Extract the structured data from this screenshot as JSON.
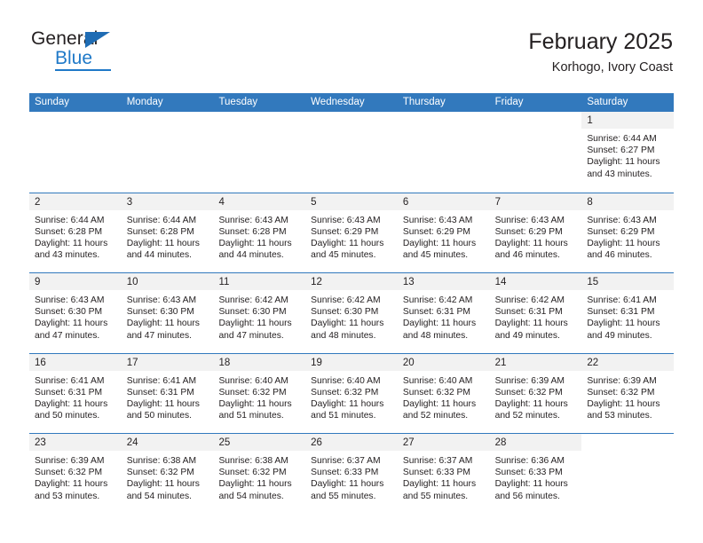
{
  "brand": {
    "name_top": "General",
    "name_bottom": "Blue",
    "triangle_icon": "brand-triangle-icon",
    "color_blue": "#1f79c8",
    "color_dark": "#231f20"
  },
  "header": {
    "title": "February 2025",
    "subtitle": "Korhogo, Ivory Coast"
  },
  "theme": {
    "header_bar": "#3279bd",
    "day_band": "#f2f2f2",
    "text": "#231f20"
  },
  "weekdays": [
    "Sunday",
    "Monday",
    "Tuesday",
    "Wednesday",
    "Thursday",
    "Friday",
    "Saturday"
  ],
  "weeks": [
    [
      {
        "day": "",
        "sunrise": "",
        "sunset": "",
        "daylight_line1": "",
        "daylight_line2": "",
        "empty": true
      },
      {
        "day": "",
        "sunrise": "",
        "sunset": "",
        "daylight_line1": "",
        "daylight_line2": "",
        "empty": true
      },
      {
        "day": "",
        "sunrise": "",
        "sunset": "",
        "daylight_line1": "",
        "daylight_line2": "",
        "empty": true
      },
      {
        "day": "",
        "sunrise": "",
        "sunset": "",
        "daylight_line1": "",
        "daylight_line2": "",
        "empty": true
      },
      {
        "day": "",
        "sunrise": "",
        "sunset": "",
        "daylight_line1": "",
        "daylight_line2": "",
        "empty": true
      },
      {
        "day": "",
        "sunrise": "",
        "sunset": "",
        "daylight_line1": "",
        "daylight_line2": "",
        "empty": true
      },
      {
        "day": "1",
        "sunrise": "Sunrise: 6:44 AM",
        "sunset": "Sunset: 6:27 PM",
        "daylight_line1": "Daylight: 11 hours",
        "daylight_line2": "and 43 minutes."
      }
    ],
    [
      {
        "day": "2",
        "sunrise": "Sunrise: 6:44 AM",
        "sunset": "Sunset: 6:28 PM",
        "daylight_line1": "Daylight: 11 hours",
        "daylight_line2": "and 43 minutes."
      },
      {
        "day": "3",
        "sunrise": "Sunrise: 6:44 AM",
        "sunset": "Sunset: 6:28 PM",
        "daylight_line1": "Daylight: 11 hours",
        "daylight_line2": "and 44 minutes."
      },
      {
        "day": "4",
        "sunrise": "Sunrise: 6:43 AM",
        "sunset": "Sunset: 6:28 PM",
        "daylight_line1": "Daylight: 11 hours",
        "daylight_line2": "and 44 minutes."
      },
      {
        "day": "5",
        "sunrise": "Sunrise: 6:43 AM",
        "sunset": "Sunset: 6:29 PM",
        "daylight_line1": "Daylight: 11 hours",
        "daylight_line2": "and 45 minutes."
      },
      {
        "day": "6",
        "sunrise": "Sunrise: 6:43 AM",
        "sunset": "Sunset: 6:29 PM",
        "daylight_line1": "Daylight: 11 hours",
        "daylight_line2": "and 45 minutes."
      },
      {
        "day": "7",
        "sunrise": "Sunrise: 6:43 AM",
        "sunset": "Sunset: 6:29 PM",
        "daylight_line1": "Daylight: 11 hours",
        "daylight_line2": "and 46 minutes."
      },
      {
        "day": "8",
        "sunrise": "Sunrise: 6:43 AM",
        "sunset": "Sunset: 6:29 PM",
        "daylight_line1": "Daylight: 11 hours",
        "daylight_line2": "and 46 minutes."
      }
    ],
    [
      {
        "day": "9",
        "sunrise": "Sunrise: 6:43 AM",
        "sunset": "Sunset: 6:30 PM",
        "daylight_line1": "Daylight: 11 hours",
        "daylight_line2": "and 47 minutes."
      },
      {
        "day": "10",
        "sunrise": "Sunrise: 6:43 AM",
        "sunset": "Sunset: 6:30 PM",
        "daylight_line1": "Daylight: 11 hours",
        "daylight_line2": "and 47 minutes."
      },
      {
        "day": "11",
        "sunrise": "Sunrise: 6:42 AM",
        "sunset": "Sunset: 6:30 PM",
        "daylight_line1": "Daylight: 11 hours",
        "daylight_line2": "and 47 minutes."
      },
      {
        "day": "12",
        "sunrise": "Sunrise: 6:42 AM",
        "sunset": "Sunset: 6:30 PM",
        "daylight_line1": "Daylight: 11 hours",
        "daylight_line2": "and 48 minutes."
      },
      {
        "day": "13",
        "sunrise": "Sunrise: 6:42 AM",
        "sunset": "Sunset: 6:31 PM",
        "daylight_line1": "Daylight: 11 hours",
        "daylight_line2": "and 48 minutes."
      },
      {
        "day": "14",
        "sunrise": "Sunrise: 6:42 AM",
        "sunset": "Sunset: 6:31 PM",
        "daylight_line1": "Daylight: 11 hours",
        "daylight_line2": "and 49 minutes."
      },
      {
        "day": "15",
        "sunrise": "Sunrise: 6:41 AM",
        "sunset": "Sunset: 6:31 PM",
        "daylight_line1": "Daylight: 11 hours",
        "daylight_line2": "and 49 minutes."
      }
    ],
    [
      {
        "day": "16",
        "sunrise": "Sunrise: 6:41 AM",
        "sunset": "Sunset: 6:31 PM",
        "daylight_line1": "Daylight: 11 hours",
        "daylight_line2": "and 50 minutes."
      },
      {
        "day": "17",
        "sunrise": "Sunrise: 6:41 AM",
        "sunset": "Sunset: 6:31 PM",
        "daylight_line1": "Daylight: 11 hours",
        "daylight_line2": "and 50 minutes."
      },
      {
        "day": "18",
        "sunrise": "Sunrise: 6:40 AM",
        "sunset": "Sunset: 6:32 PM",
        "daylight_line1": "Daylight: 11 hours",
        "daylight_line2": "and 51 minutes."
      },
      {
        "day": "19",
        "sunrise": "Sunrise: 6:40 AM",
        "sunset": "Sunset: 6:32 PM",
        "daylight_line1": "Daylight: 11 hours",
        "daylight_line2": "and 51 minutes."
      },
      {
        "day": "20",
        "sunrise": "Sunrise: 6:40 AM",
        "sunset": "Sunset: 6:32 PM",
        "daylight_line1": "Daylight: 11 hours",
        "daylight_line2": "and 52 minutes."
      },
      {
        "day": "21",
        "sunrise": "Sunrise: 6:39 AM",
        "sunset": "Sunset: 6:32 PM",
        "daylight_line1": "Daylight: 11 hours",
        "daylight_line2": "and 52 minutes."
      },
      {
        "day": "22",
        "sunrise": "Sunrise: 6:39 AM",
        "sunset": "Sunset: 6:32 PM",
        "daylight_line1": "Daylight: 11 hours",
        "daylight_line2": "and 53 minutes."
      }
    ],
    [
      {
        "day": "23",
        "sunrise": "Sunrise: 6:39 AM",
        "sunset": "Sunset: 6:32 PM",
        "daylight_line1": "Daylight: 11 hours",
        "daylight_line2": "and 53 minutes."
      },
      {
        "day": "24",
        "sunrise": "Sunrise: 6:38 AM",
        "sunset": "Sunset: 6:32 PM",
        "daylight_line1": "Daylight: 11 hours",
        "daylight_line2": "and 54 minutes."
      },
      {
        "day": "25",
        "sunrise": "Sunrise: 6:38 AM",
        "sunset": "Sunset: 6:32 PM",
        "daylight_line1": "Daylight: 11 hours",
        "daylight_line2": "and 54 minutes."
      },
      {
        "day": "26",
        "sunrise": "Sunrise: 6:37 AM",
        "sunset": "Sunset: 6:33 PM",
        "daylight_line1": "Daylight: 11 hours",
        "daylight_line2": "and 55 minutes."
      },
      {
        "day": "27",
        "sunrise": "Sunrise: 6:37 AM",
        "sunset": "Sunset: 6:33 PM",
        "daylight_line1": "Daylight: 11 hours",
        "daylight_line2": "and 55 minutes."
      },
      {
        "day": "28",
        "sunrise": "Sunrise: 6:36 AM",
        "sunset": "Sunset: 6:33 PM",
        "daylight_line1": "Daylight: 11 hours",
        "daylight_line2": "and 56 minutes."
      },
      {
        "day": "",
        "sunrise": "",
        "sunset": "",
        "daylight_line1": "",
        "daylight_line2": "",
        "empty": true
      }
    ]
  ]
}
